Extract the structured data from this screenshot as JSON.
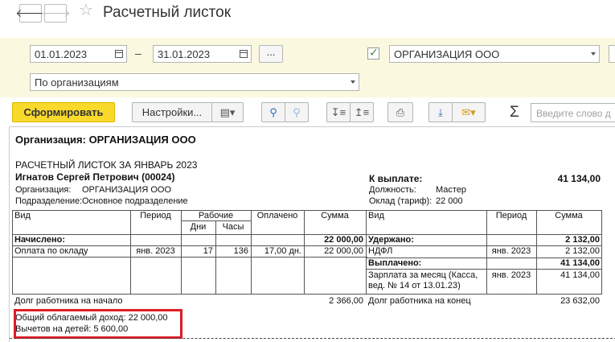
{
  "window": {
    "title": "Расчетный листок",
    "back_icon": "arrow-left-icon",
    "forward_icon": "arrow-right-icon",
    "favorite_icon": "star-icon"
  },
  "params": {
    "date_from": "01.01.2023",
    "date_separator": "–",
    "date_to": "31.01.2023",
    "period_button": "...",
    "organization_checked": true,
    "organization": "ОРГАНИЗАЦИЯ ООО",
    "grouping": "По организациям"
  },
  "toolbar": {
    "generate": "Сформировать",
    "settings": "Настройки...",
    "search_placeholder": "Введите слово д"
  },
  "colors": {
    "params_bg": "#fbf8e0",
    "primary_button": "#f9d92a",
    "highlight_border": "#e01b24",
    "checkbox_check": "#3a8f3a"
  },
  "report": {
    "organization_heading": "Организация: ОРГАНИЗАЦИЯ ООО",
    "sheet_title": "РАСЧЕТНЫЙ ЛИСТОК ЗА ЯНВАРЬ 2023",
    "employee": "Игнатов Сергей Петрович (00024)",
    "org_label": "Организация:",
    "org_value": "ОРГАНИЗАЦИЯ ООО",
    "department_label": "Подразделение:",
    "department_value": "Основное подразделение",
    "payout_label": "К выплате:",
    "payout_value": "41 134,00",
    "position_label": "Должность:",
    "position_value": "Мастер",
    "salary_label": "Оклад (тариф):",
    "salary_value": "22 000",
    "headers": {
      "kind": "Вид",
      "period": "Период",
      "work": "Рабочие",
      "days": "Дни",
      "hours": "Часы",
      "paid": "Оплачено",
      "sum": "Сумма",
      "kind_r": "Вид",
      "period_r": "Период",
      "sum_r": "Сумма"
    },
    "accrued_label": "Начислено:",
    "accrued_total": "22 000,00",
    "withheld_label": "Удержано:",
    "withheld_total": "2 132,00",
    "salary_row": {
      "kind": "Оплата по окладу",
      "period": "янв. 2023",
      "days": "17",
      "hours": "136",
      "paid": "17,00 дн.",
      "sum": "22 000,00"
    },
    "ndfl_row": {
      "kind": "НДФЛ",
      "period": "янв. 2023",
      "sum": "2 132,00"
    },
    "paid_out_label": "Выплачено:",
    "paid_out_total": "41 134,00",
    "payment_row": {
      "kind_line1": "Зарплата за месяц (Касса,",
      "kind_line2": "вед. № 14 от 13.01.23)",
      "period": "янв. 2023",
      "sum": "41 134,00"
    },
    "debt_start_label": "Долг работника на начало",
    "debt_start_value": "2 366,00",
    "debt_end_label": "Долг работника на конец",
    "debt_end_value": "23 632,00",
    "taxable_income": "Общий облагаемый доход: 22 000,00",
    "child_deductions": "Вычетов на детей: 5 600,00"
  }
}
